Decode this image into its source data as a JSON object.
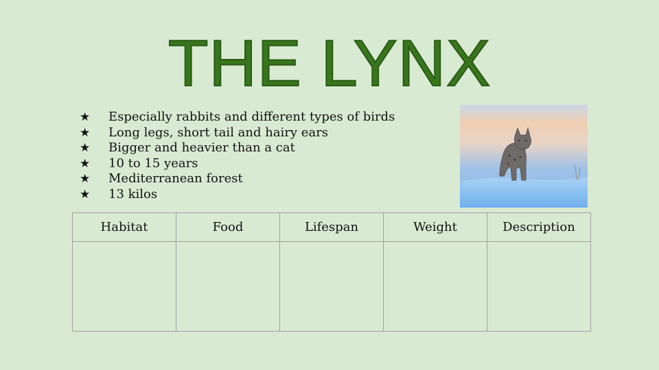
{
  "slide": {
    "title": "THE LYNX",
    "facts": [
      "Especially rabbits and different types of birds",
      "Long legs, short tail and hairy ears",
      "Bigger and heavier than a cat",
      "10 to 15 years",
      "Mediterranean forest",
      "13 kilos"
    ],
    "bullet_glyph": "★",
    "photo_icon": "lynx-photo",
    "table": {
      "headers": [
        "Habitat",
        "Food",
        "Lifespan",
        "Weight",
        "Description"
      ],
      "cells": [
        "",
        "",
        "",
        "",
        ""
      ]
    }
  },
  "colors": {
    "background": "#d9ead3",
    "title": "#38761d",
    "border": "#9e9e9e"
  }
}
